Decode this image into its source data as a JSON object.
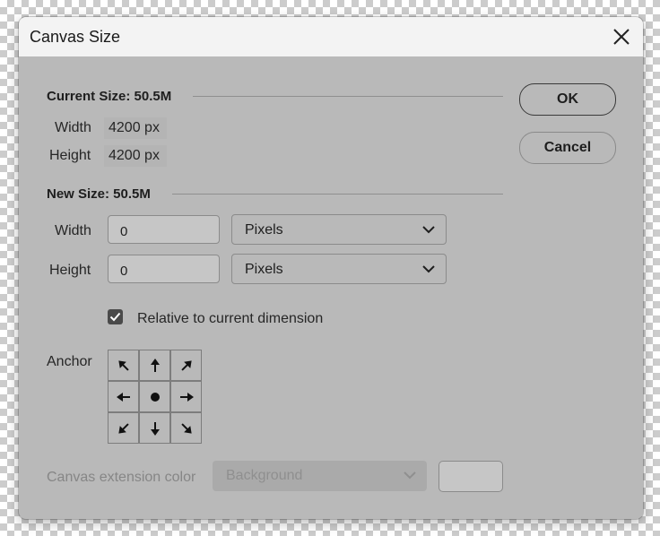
{
  "title": "Canvas Size",
  "current_size": {
    "heading": "Current Size: 50.5M",
    "width_label": "Width",
    "width_value": "4200 px",
    "height_label": "Height",
    "height_value": "4200 px"
  },
  "new_size": {
    "heading": "New Size: 50.5M",
    "width_label": "Width",
    "width_value": "0",
    "width_unit": "Pixels",
    "height_label": "Height",
    "height_value": "0",
    "height_unit": "Pixels"
  },
  "relative": {
    "label": "Relative to current dimension",
    "checked": true
  },
  "anchor": {
    "label": "Anchor",
    "cells": [
      "arrow-up-left-icon",
      "arrow-up-icon",
      "arrow-up-right-icon",
      "arrow-left-icon",
      "anchor-center-dot-icon",
      "arrow-right-icon",
      "arrow-down-left-icon",
      "arrow-down-icon",
      "arrow-down-right-icon"
    ]
  },
  "extension": {
    "label": "Canvas extension color",
    "value": "Background"
  },
  "buttons": {
    "ok": "OK",
    "cancel": "Cancel"
  },
  "colors": {
    "dialog_bg": "#b9b9b9",
    "titlebar_bg": "#f3f3f3"
  }
}
